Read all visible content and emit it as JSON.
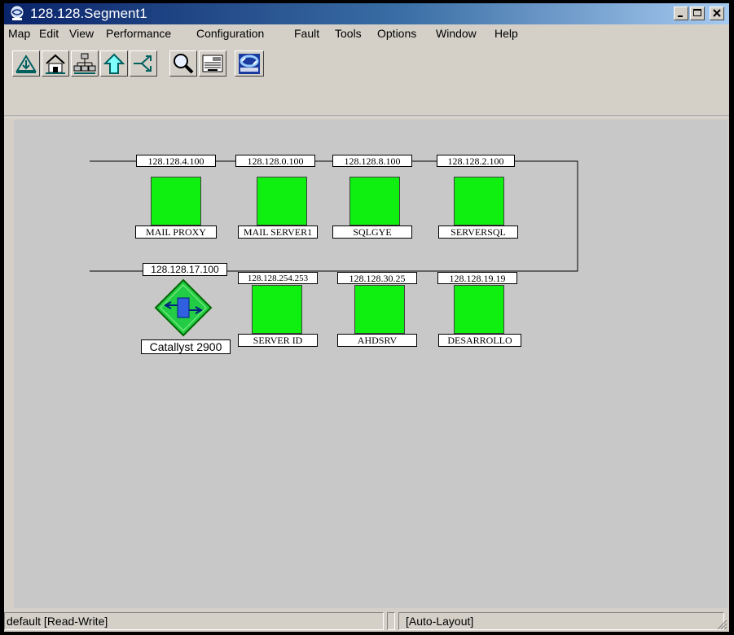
{
  "window": {
    "title": "128.128.Segment1",
    "icon": "network-map-icon"
  },
  "menubar": {
    "items": [
      "Map",
      "Edit",
      "View",
      "Performance",
      "Configuration",
      "Fault",
      "Tools",
      "Options",
      "Window",
      "Help"
    ]
  },
  "toolbar": {
    "buttons": [
      "close-submap-icon",
      "home-submap-icon",
      "root-submap-icon",
      "parent-submap-icon",
      "quick-navigator-icon",
      "find-icon",
      "alarm-browser-icon",
      "hp-openview-icon"
    ]
  },
  "map": {
    "nodes": [
      {
        "ip": "128.128.4.100",
        "name": "MAIL PROXY"
      },
      {
        "ip": "128.128.0.100",
        "name": "MAIL SERVER1"
      },
      {
        "ip": "128.128.8.100",
        "name": "SQLGYE"
      },
      {
        "ip": "128.128.2.100",
        "name": "SERVERSQL"
      },
      {
        "ip": "128.128.254.253",
        "name": "SERVER ID"
      },
      {
        "ip": "128.128.30.25",
        "name": "AHDSRV"
      },
      {
        "ip": "128.128.19.19",
        "name": "DESARROLLO"
      }
    ],
    "switch": {
      "ip": "128.128.17.100",
      "name": "Catallyst 2900"
    }
  },
  "statusbar": {
    "mode": "default [Read-Write]",
    "layout": "[Auto-Layout]"
  },
  "colors": {
    "node_fill": "#10f010",
    "canvas": "#c8c8c8",
    "switch_fill": "#22cc44"
  }
}
